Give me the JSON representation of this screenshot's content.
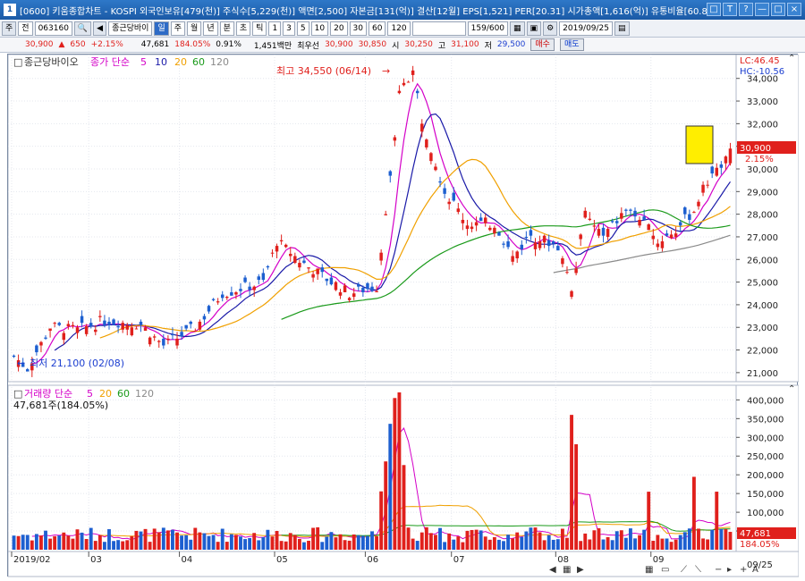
{
  "window": {
    "title": "[0600] 키움종합차트 - KOSPI 외국인보유[479(천)] 주식수[5,229(천)] 액면[2,500] 자본금[131(억)] 결산[12월] EPS[1,521] PER[20.31] 시가총액[1,616(억)] 유통비율[60.8]",
    "icon_label": "1",
    "buttons": [
      "□",
      "T",
      "?",
      "—",
      "□",
      "×"
    ]
  },
  "toolbar": {
    "type": "주",
    "type2": "전",
    "code": "063160",
    "stock_name": "종근당바이",
    "period_tabs": [
      "일",
      "주",
      "월",
      "년",
      "분",
      "초",
      "틱"
    ],
    "selected_tab": "일",
    "intervals": [
      "1",
      "3",
      "5",
      "10",
      "20",
      "30",
      "60",
      "120"
    ],
    "count": "159/600",
    "date": "2019/09/25"
  },
  "info": {
    "price": "30,900",
    "change": "650",
    "change_pct": "+2.15%",
    "volume": "47,681",
    "vol_ratio": "184.05%",
    "turnover": "0.91%",
    "amount": "1,451백만",
    "best_ask_label": "최우선",
    "best_ask": "30,900",
    "best_bid": "30,850",
    "open_label": "시",
    "open": "30,250",
    "high_label": "고",
    "high": "31,100",
    "low_label": "저",
    "low": "29,500",
    "buy_btn": "매수",
    "sell_btn": "매도"
  },
  "price_panel": {
    "title": "종근당바이오",
    "legend_label": "종가 단순",
    "ma_periods": [
      "5",
      "10",
      "20",
      "60",
      "120"
    ],
    "ma_colors": [
      "#d400c8",
      "#1a1aa8",
      "#f0a000",
      "#1a9a1a",
      "#8a8a8a"
    ],
    "lc": "LC:46.45",
    "hc": "HC:-10.56",
    "max_label": "최고 34,550 (06/14)",
    "min_label": "최저 21,100 (02/08)",
    "last_price": "30,900",
    "last_pct": "2.15%",
    "y_ticks": [
      "34,000",
      "33,000",
      "32,000",
      "31,000",
      "30,000",
      "29,000",
      "28,000",
      "27,000",
      "26,000",
      "25,000",
      "24,000",
      "23,000",
      "22,000",
      "21,000"
    ]
  },
  "volume_panel": {
    "title": "거래량 단순",
    "ma_periods": [
      "5",
      "20",
      "60",
      "120"
    ],
    "current": "47,681주(184.05%)",
    "last_vol": "47,681",
    "last_pct": "184.05%",
    "y_ticks": [
      "400,000",
      "350,000",
      "300,000",
      "250,000",
      "200,000",
      "150,000",
      "100,000",
      "50,000"
    ]
  },
  "x_axis": {
    "labels": [
      "2019/02",
      "03",
      "04",
      "05",
      "06",
      "07",
      "08",
      "09"
    ],
    "end_label": "09/25"
  },
  "chart_data": {
    "type": "candlestick",
    "close_start": 21600,
    "close_end": 30900,
    "price_range": [
      20600,
      34700
    ],
    "volume_range": [
      0,
      420000
    ],
    "high": 34550,
    "low": 21100
  }
}
